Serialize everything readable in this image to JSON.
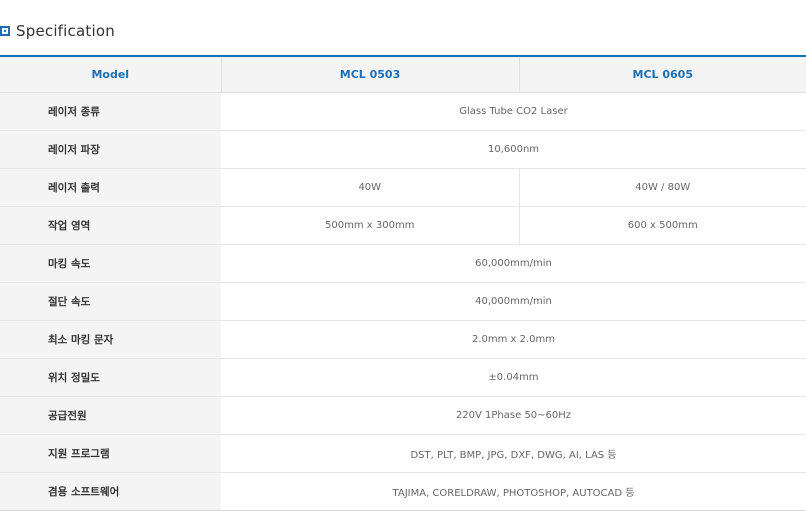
{
  "section": {
    "icon": "square-bullet-icon",
    "title": "Specification"
  },
  "colors": {
    "accent": "#1b6fb8",
    "header_bg": "#f4f4f4"
  },
  "table": {
    "header": {
      "label": "Model",
      "col1": "MCL 0503",
      "col2": "MCL 0605"
    },
    "rows": [
      {
        "label": "레이저 종류",
        "value": "Glass Tube CO2 Laser"
      },
      {
        "label": "레이저 파장",
        "value": "10,600nm"
      },
      {
        "label": "레이저 출력",
        "col1": "40W",
        "col2": "40W / 80W"
      },
      {
        "label": "작업 영역",
        "col1": "500mm x 300mm",
        "col2": "600 x 500mm"
      },
      {
        "label": "마킹 속도",
        "value": "60,000mm/min"
      },
      {
        "label": "절단 속도",
        "value": "40,000mm/min"
      },
      {
        "label": "최소 마킹 문자",
        "value": "2.0mm x 2.0mm"
      },
      {
        "label": "위치 정밀도",
        "value": "±0.04mm"
      },
      {
        "label": "공급전원",
        "value": "220V 1Phase 50~60Hz"
      },
      {
        "label": "지원 프로그램",
        "value": "DST, PLT, BMP, JPG, DXF, DWG, AI, LAS 등"
      },
      {
        "label": "겸용 소프트웨어",
        "value": "TAJIMA, CORELDRAW, PHOTOSHOP, AUTOCAD 등"
      }
    ]
  }
}
